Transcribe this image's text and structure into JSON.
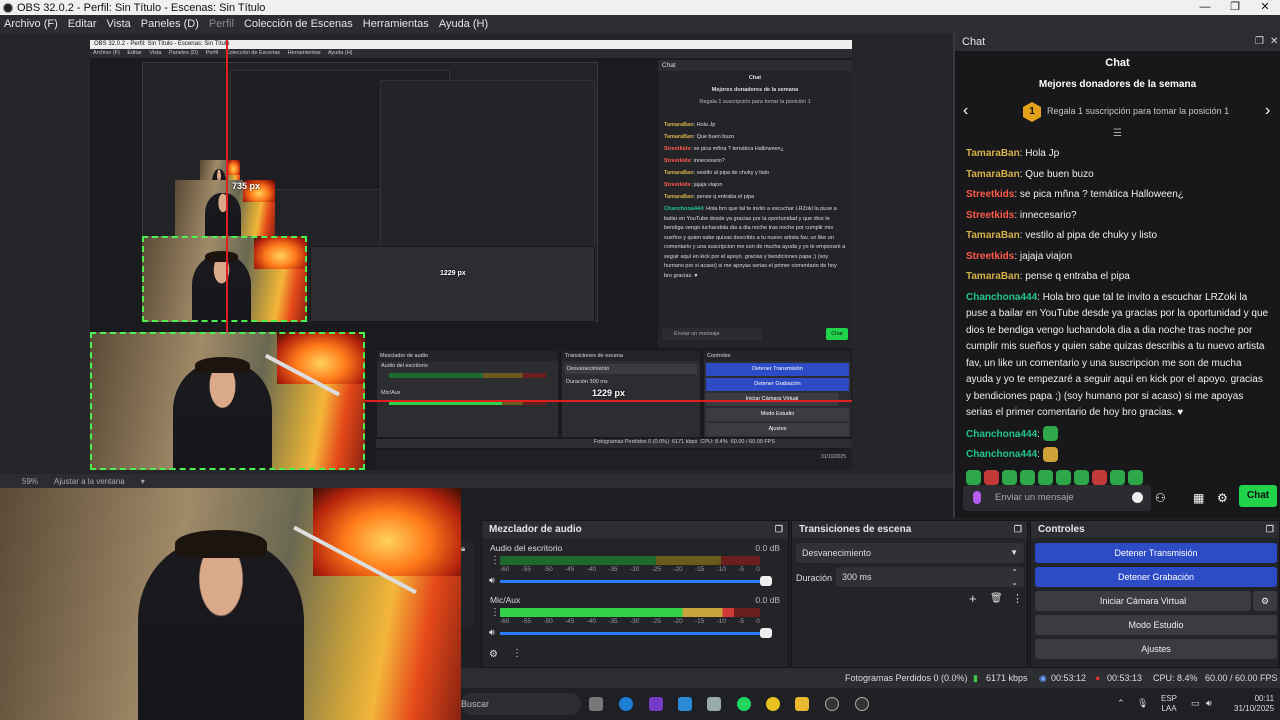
{
  "window": {
    "title": "OBS 32.0.2 - Perfil: Sin Título - Escenas: Sin Título",
    "minimize": "—",
    "maximize": "❐",
    "close": "✕"
  },
  "menu": {
    "items": [
      "Archivo (F)",
      "Editar",
      "Vista",
      "Paneles (D)",
      "Perfil",
      "Colección de Escenas",
      "Herramientas",
      "Ayuda (H)"
    ]
  },
  "preview": {
    "size_label_small": "735 px",
    "size_label_large": "1229 px",
    "zoom": "59%",
    "fit": "Ajustar a la ventana"
  },
  "nested": {
    "title": "OBS 32.0.2 - Perfil: Sin Título - Escenas: Sin Título",
    "menu": [
      "Archivo (F)",
      "Editar",
      "Vista",
      "Paneles (D)",
      "Perfil",
      "Colección de Escenas",
      "Herramientas",
      "Ayuda (H)"
    ],
    "mixer_title": "Mezclador de audio",
    "transitions_title": "Transiciones de escena",
    "controls_title": "Controles",
    "chat_title": "Chat",
    "src1": "Audio del escritorio",
    "src2": "Mic/Aux",
    "transition": "Desvanecimiento",
    "duration_label": "Duración",
    "duration": "300 ms",
    "btn_stream": "Detener Transmisión",
    "btn_record": "Detener Grabación",
    "btn_virtual": "Iniciar Cámara Virtual",
    "btn_studio": "Modo Estudio",
    "btn_settings": "Ajustes",
    "status": "Fotogramas Perdidos 0 (0.0%)",
    "kbps": "6171 kbps",
    "fps": "60.00 / 60.00 FPS",
    "cpu": "CPU: 8.4%",
    "date": "31/10/2025"
  },
  "chat": {
    "dock_title": "Chat",
    "header": "Chat",
    "donors_title": "Mejores donadores de la semana",
    "donor_rank": "1",
    "donor_text": "Regala 1 suscripción para tomar la posición 1",
    "messages": [
      {
        "user": "TamaraBan",
        "text": ": Hola Jp"
      },
      {
        "user": "TamaraBan",
        "text": ": Que buen buzo"
      },
      {
        "user": "Streetkids",
        "text": ": se pica mñna ? temática Halloween¿"
      },
      {
        "user": "Streetkids",
        "text": ": innecesario?"
      },
      {
        "user": "TamaraBan",
        "text": ": vestilo al pipa de chuky y listo"
      },
      {
        "user": "Streetkids",
        "text": ": jajaja viajon"
      },
      {
        "user": "TamaraBan",
        "text": ": pense q entraba el pipa"
      },
      {
        "user": "Chanchona444",
        "text": ": Hola bro que tal te invito a escuchar LRZoki la puse a bailar en YouTube desde ya gracias por la oportunidad y que dios te bendiga vengo luchandola dia a dia noche tras noche por cumplir mis sueños y quien sabe quizas describis a tu nuevo artista fav, un like un comentario y una suscripcion me son de mucha ayuda y yo te empezaré a seguir aquí en kick por el apoyo. gracias y bendiciones papa ;) (soy humano por si acaso) si me apoyas serias el primer comentario de hoy bro gracias. ♥"
      },
      {
        "user": "Chanchona444",
        "text": ":"
      },
      {
        "user": "Chanchona444",
        "text": ":"
      }
    ],
    "input_placeholder": "Enviar un mensaje",
    "send_label": "Chat"
  },
  "mixer": {
    "title": "Mezclador de audio",
    "sources": [
      {
        "name": "Audio del escritorio",
        "db": "0.0 dB",
        "level": 0.0
      },
      {
        "name": "Mic/Aux",
        "db": "0.0 dB",
        "level": 0.9
      }
    ],
    "scale": [
      "-60",
      "-55",
      "-50",
      "-45",
      "-40",
      "-35",
      "-30",
      "-25",
      "-20",
      "-15",
      "-10",
      "-5",
      "0"
    ]
  },
  "transitions": {
    "title": "Transiciones de escena",
    "selected": "Desvanecimiento",
    "duration_label": "Duración",
    "duration": "300 ms"
  },
  "controls": {
    "title": "Controles",
    "stream": "Detener Transmisión",
    "record": "Detener Grabación",
    "virtual_cam": "Iniciar Cámara Virtual",
    "studio": "Modo Estudio",
    "settings": "Ajustes"
  },
  "status": {
    "dropped": "Fotogramas Perdidos 0 (0.0%)",
    "bitrate": "6171 kbps",
    "stream_time": "00:53:12",
    "record_time": "00:53:13",
    "cpu": "CPU: 8.4%",
    "fps": "60.00 / 60.00 FPS"
  },
  "taskbar": {
    "search": "Buscar",
    "lang": "ESP",
    "region": "LAA",
    "time": "00:11",
    "date": "31/10/2025"
  },
  "colors": {
    "accent_blue": "#2e4bc6",
    "kick_green": "#20d34a",
    "select_green": "#4ef24e",
    "guide_red": "#e02020"
  }
}
